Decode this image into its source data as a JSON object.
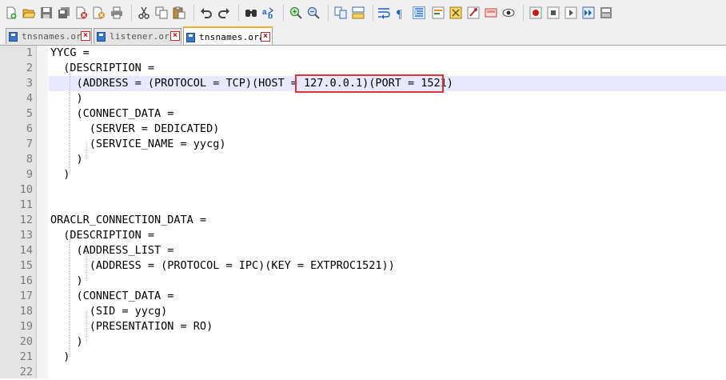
{
  "tabs": [
    {
      "label": "tnsnames.ora",
      "active": false
    },
    {
      "label": "listener.ora",
      "active": false
    },
    {
      "label": "tnsnames.ora",
      "active": true
    }
  ],
  "toolbar": {
    "icons": [
      "new-file-icon",
      "open-file-icon",
      "save-icon",
      "save-all-icon",
      "close-icon",
      "close-all-icon",
      "print-icon",
      "cut-icon",
      "copy-icon",
      "paste-icon",
      "undo-icon",
      "redo-icon",
      "find-icon",
      "replace-icon",
      "zoom-in-icon",
      "zoom-out-icon",
      "sync-vertical-icon",
      "sync-horizontal-icon",
      "word-wrap-icon",
      "show-all-chars-icon",
      "indent-guide-icon",
      "language-icon",
      "function-list-icon",
      "folder-workspace-icon",
      "doc-map-icon",
      "monitor-icon",
      "record-macro-icon",
      "stop-macro-icon",
      "play-macro-icon",
      "run-macro-icon",
      "save-macro-icon"
    ]
  },
  "editor": {
    "lines": [
      {
        "n": "1",
        "text": "YYCG ="
      },
      {
        "n": "2",
        "text": "  (DESCRIPTION ="
      },
      {
        "n": "3",
        "text": "    (ADDRESS = (PROTOCOL = TCP)(HOST = 127.0.0.1)(PORT = 1521)"
      },
      {
        "n": "4",
        "text": "    )"
      },
      {
        "n": "5",
        "text": "    (CONNECT_DATA ="
      },
      {
        "n": "6",
        "text": "      (SERVER = DEDICATED)"
      },
      {
        "n": "7",
        "text": "      (SERVICE_NAME = yycg)"
      },
      {
        "n": "8",
        "text": "    )"
      },
      {
        "n": "9",
        "text": "  )"
      },
      {
        "n": "10",
        "text": ""
      },
      {
        "n": "11",
        "text": ""
      },
      {
        "n": "12",
        "text": "ORACLR_CONNECTION_DATA ="
      },
      {
        "n": "13",
        "text": "  (DESCRIPTION ="
      },
      {
        "n": "14",
        "text": "    (ADDRESS_LIST ="
      },
      {
        "n": "15",
        "text": "      (ADDRESS = (PROTOCOL = IPC)(KEY = EXTPROC1521))"
      },
      {
        "n": "16",
        "text": "    )"
      },
      {
        "n": "17",
        "text": "    (CONNECT_DATA ="
      },
      {
        "n": "18",
        "text": "      (SID = yycg)"
      },
      {
        "n": "19",
        "text": "      (PRESENTATION = RO)"
      },
      {
        "n": "20",
        "text": "    )"
      },
      {
        "n": "21",
        "text": "  )"
      },
      {
        "n": "22",
        "text": ""
      }
    ],
    "current_line": "3",
    "highlight_color": "#e0333a"
  }
}
